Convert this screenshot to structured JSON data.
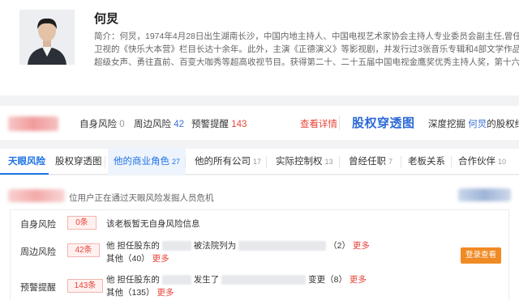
{
  "profile": {
    "name": "何炅",
    "bio_lines": [
      "简介：何炅，1974年4月28日出生湖南长沙，中国内地主持人、中国电视艺术家协会主持人专业委员会副主任,曾任北京外国语大",
      "卫视的《快乐大本营》栏目长达十余年。此外，主演《正德演义》等影视剧，并发行过3张音乐专辑和4部文学作品。2004年发表",
      "超级女声、勇往直前、百变大咖秀等超高收视节目。获得第二十、二十五届中国电视金鹰奖优秀主持人奖，第十六届上海电视"
    ]
  },
  "risk_summary": {
    "self_risk_label": "自身风险",
    "self_risk_count": "0",
    "surround_risk_label": "周边风险",
    "surround_risk_count": "42",
    "warning_label": "预警提醒",
    "warning_count": "143",
    "view_detail": "查看详情",
    "equity_logo": "股权穿透图",
    "deep_mine_label": "深度挖掘",
    "deep_mine_name": "何炅",
    "deep_mine_suffix": "的股权结"
  },
  "tabs": [
    {
      "label": "天眼风险",
      "count": ""
    },
    {
      "label": "股权穿透图",
      "count": ""
    },
    {
      "label": "他的商业角色",
      "count": "27"
    },
    {
      "label": "他的所有公司",
      "count": "17"
    },
    {
      "label": "实际控制权",
      "count": "13"
    },
    {
      "label": "曾经任职",
      "count": "7"
    },
    {
      "label": "老板关系",
      "count": ""
    },
    {
      "label": "合作伙伴",
      "count": "10"
    }
  ],
  "content": {
    "notice": "位用户正在通过天眼风险发掘人员危机",
    "rows": {
      "self": {
        "label": "自身风险",
        "chip": "0条",
        "text": "该老板暂无自身风险信息"
      },
      "surround": {
        "label": "周边风险",
        "chip": "42条",
        "line1_a": "他 担任股东的",
        "line1_b": "被法院列为",
        "line1_c": "（2）",
        "more": "更多",
        "line2_a": "其他（40）"
      },
      "warning": {
        "label": "预警提醒",
        "chip": "143条",
        "line1_a": "他 担任股东的",
        "line1_b": "发生了",
        "line1_c": "变更（8）",
        "line2_a": "其他（135）"
      }
    },
    "login_button": "登录查看"
  }
}
